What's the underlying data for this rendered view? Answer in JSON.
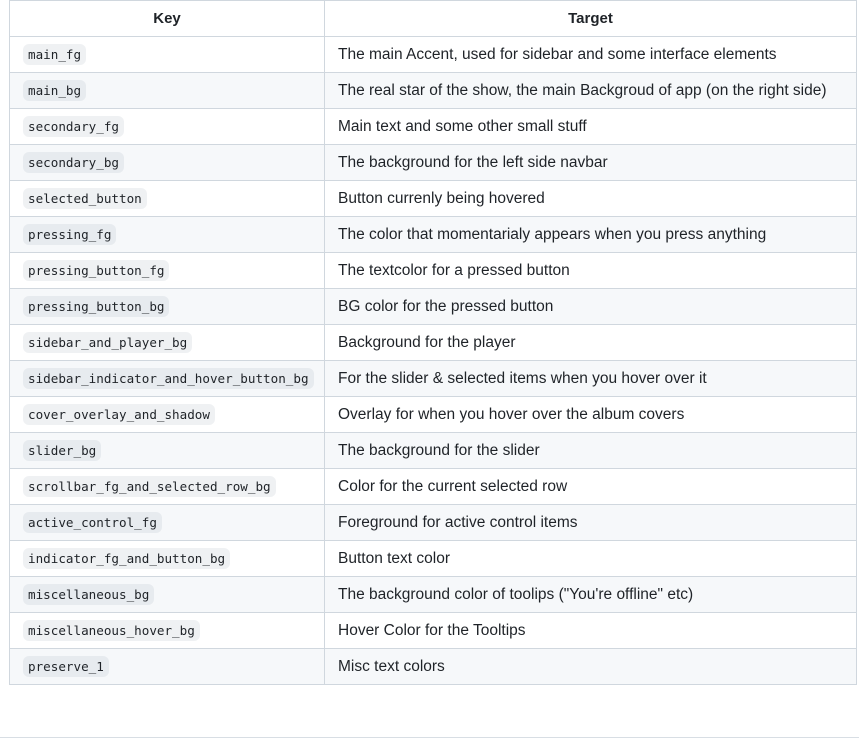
{
  "table": {
    "headers": {
      "key": "Key",
      "target": "Target"
    },
    "rows": [
      {
        "key": "main_fg",
        "target": "The main Accent, used for sidebar and some interface elements"
      },
      {
        "key": "main_bg",
        "target": "The real star of the show, the main Backgroud of app (on the right side)"
      },
      {
        "key": "secondary_fg",
        "target": "Main text and some other small stuff"
      },
      {
        "key": "secondary_bg",
        "target": "The background for the left side navbar"
      },
      {
        "key": "selected_button",
        "target": "Button currenly being hovered"
      },
      {
        "key": "pressing_fg",
        "target": "The color that momentarialy appears when you press anything"
      },
      {
        "key": "pressing_button_fg",
        "target": "The textcolor for a pressed button"
      },
      {
        "key": "pressing_button_bg",
        "target": "BG color for the pressed button"
      },
      {
        "key": "sidebar_and_player_bg",
        "target": "Background for the player"
      },
      {
        "key": "sidebar_indicator_and_hover_button_bg",
        "target": "For the slider & selected items when you hover over it"
      },
      {
        "key": "cover_overlay_and_shadow",
        "target": "Overlay for when you hover over the album covers"
      },
      {
        "key": "slider_bg",
        "target": "The background for the slider"
      },
      {
        "key": "scrollbar_fg_and_selected_row_bg",
        "target": "Color for the current selected row"
      },
      {
        "key": "active_control_fg",
        "target": "Foreground for active control items"
      },
      {
        "key": "indicator_fg_and_button_bg",
        "target": "Button text color"
      },
      {
        "key": "miscellaneous_bg",
        "target": "The background color of toolips (\"You're offline\" etc)"
      },
      {
        "key": "miscellaneous_hover_bg",
        "target": "Hover Color for the Tooltips"
      },
      {
        "key": "preserve_1",
        "target": "Misc text colors"
      }
    ]
  }
}
